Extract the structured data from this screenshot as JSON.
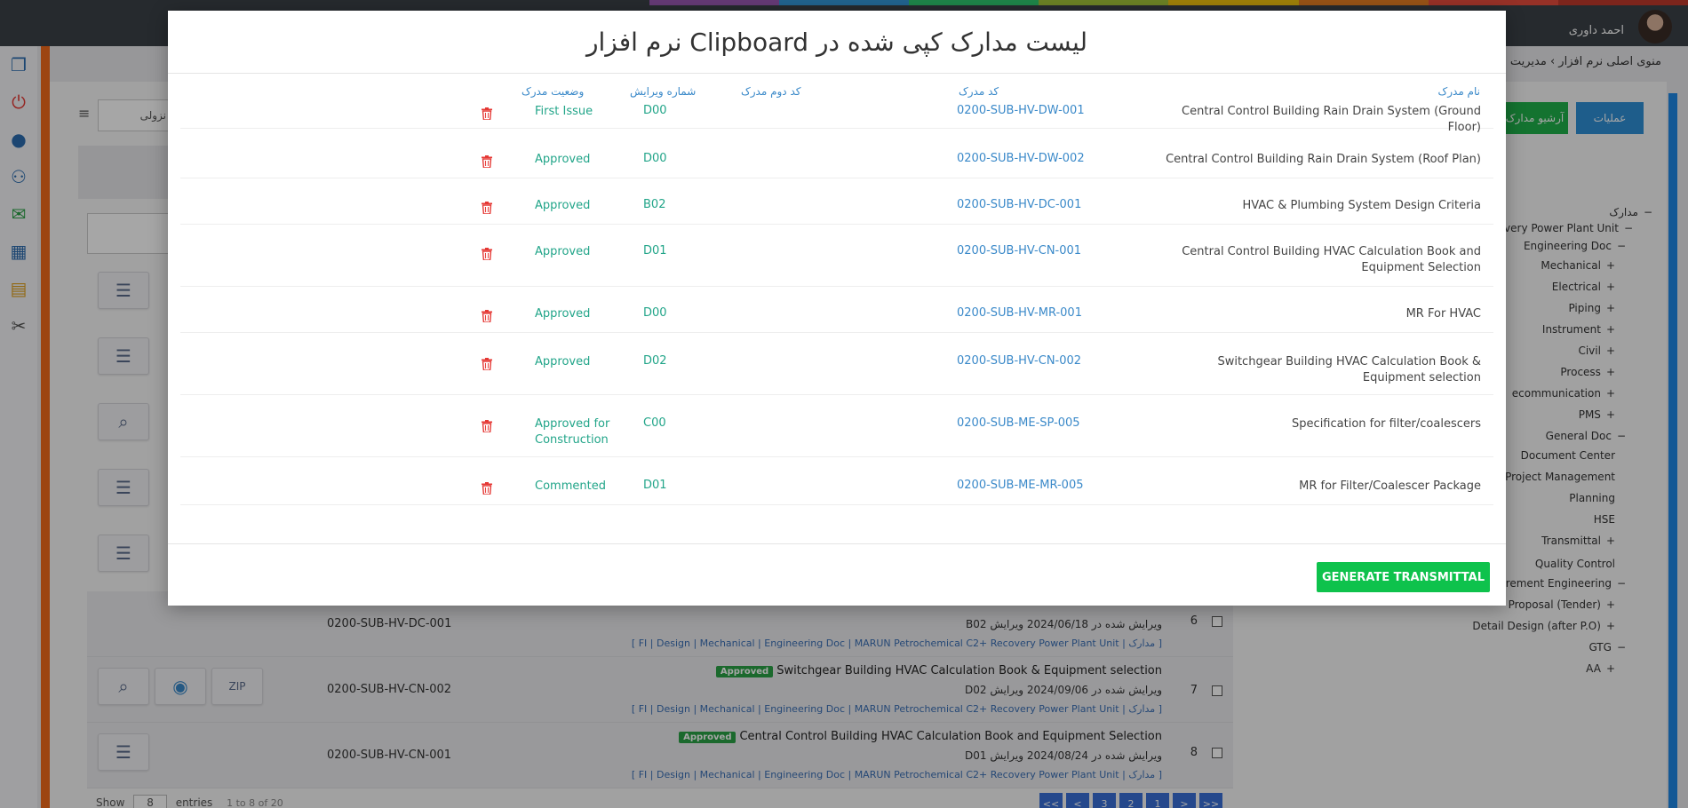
{
  "header": {
    "user_name": "احمد داوری",
    "breadcrumb": "منوی اصلی نرم افزار  ›  مدیریت",
    "rainbow": [
      "#3b4147",
      "#3b4147",
      "#3b4147",
      "#3b4147",
      "#3b4147",
      "#9b59b6",
      "#3498db",
      "#2ecc71",
      "#a4c639",
      "#f1c40f",
      "#e67e22",
      "#e74c3c",
      "#c0392b"
    ]
  },
  "background": {
    "filter_label": "نزولی",
    "btn_ops": "عملیات",
    "btn_archive": "آرشیو مدارک",
    "rows": [
      {
        "num": "6",
        "code": "0200-SUB-HV-DC-001",
        "badge": "",
        "title": "",
        "revline": "ویرایش شده در  2024/06/18   ویرایش B02",
        "path": "[ FI | Design | Mechanical | Engineering Doc | MARUN Petrochemical C2+ Recovery Power Plant Unit | مدارک ]"
      },
      {
        "num": "7",
        "code": "0200-SUB-HV-CN-002",
        "badge": "Approved",
        "title": "Switchgear Building HVAC Calculation Book & Equipment selection",
        "revline": "ویرایش شده در  2024/09/06   ویرایش D02",
        "path": "[ FI | Design | Mechanical | Engineering Doc | MARUN Petrochemical C2+ Recovery Power Plant Unit | مدارک ]"
      },
      {
        "num": "8",
        "code": "0200-SUB-HV-CN-001",
        "badge": "Approved",
        "title": "Central Control Building HVAC Calculation Book and Equipment Selection",
        "revline": "ویرایش شده در  2024/08/24   ویرایش D01",
        "path": "[ FI | Design | Mechanical | Engineering Doc | MARUN Petrochemical C2+ Recovery Power Plant Unit | مدارک ]"
      }
    ],
    "show_label": "Show",
    "show_value": "8",
    "entries_label": "entries",
    "entries_info": "1 to 8 of 20",
    "pager": [
      "<<",
      "<",
      "3",
      "2",
      "1",
      ">",
      ">>"
    ],
    "tree": [
      {
        "label": "مدارک",
        "sign": "−"
      },
      {
        "label": "overy Power Plant Unit",
        "sign": "−"
      },
      {
        "label": "Engineering Doc",
        "sign": "−"
      },
      {
        "label": "Mechanical",
        "sign": "+"
      },
      {
        "label": "Electrical",
        "sign": "+"
      },
      {
        "label": "Piping",
        "sign": "+"
      },
      {
        "label": "Instrument",
        "sign": "+"
      },
      {
        "label": "Civil",
        "sign": "+"
      },
      {
        "label": "Process",
        "sign": "+"
      },
      {
        "label": "ecommunication",
        "sign": "+"
      },
      {
        "label": "PMS",
        "sign": "+"
      },
      {
        "label": "General Doc",
        "sign": "−"
      },
      {
        "label": "Document Center",
        "sign": ""
      },
      {
        "label": "Project Management",
        "sign": ""
      },
      {
        "label": "Planning",
        "sign": ""
      },
      {
        "label": "HSE",
        "sign": ""
      },
      {
        "label": "Transmittal",
        "sign": "+"
      },
      {
        "label": "Quality Control",
        "sign": ""
      },
      {
        "label": "rement Engineering",
        "sign": "−"
      },
      {
        "label": "Proposal (Tender)",
        "sign": "+"
      },
      {
        "label": "Detail Design (after P.O)",
        "sign": "+"
      },
      {
        "label": "GTG",
        "sign": "−"
      },
      {
        "label": "AA",
        "sign": "+"
      }
    ]
  },
  "modal": {
    "title": "لیست مدارک کپی شده در Clipboard نرم افزار",
    "columns": {
      "name": "نام مدرک",
      "code": "کد مدرک",
      "second_code": "کد دوم مدرک",
      "revision": "شماره ویرایش",
      "status": "وضعیت مدرک"
    },
    "rows": [
      {
        "name": "Central Control Building Rain Drain System (Ground Floor)",
        "code": "0200-SUB-HV-DW-001",
        "rev": "D00",
        "status": "First Issue"
      },
      {
        "name": "Central Control Building Rain Drain System (Roof Plan)",
        "code": "0200-SUB-HV-DW-002",
        "rev": "D00",
        "status": "Approved"
      },
      {
        "name": "HVAC & Plumbing System Design Criteria",
        "code": "0200-SUB-HV-DC-001",
        "rev": "B02",
        "status": "Approved"
      },
      {
        "name": "Central Control Building HVAC Calculation Book and Equipment Selection",
        "code": "0200-SUB-HV-CN-001",
        "rev": "D01",
        "status": "Approved"
      },
      {
        "name": "MR For HVAC",
        "code": "0200-SUB-HV-MR-001",
        "rev": "D00",
        "status": "Approved"
      },
      {
        "name": "Switchgear Building HVAC Calculation Book & Equipment selection",
        "code": "0200-SUB-HV-CN-002",
        "rev": "D02",
        "status": "Approved"
      },
      {
        "name": "Specification for filter/coalescers",
        "code": "0200-SUB-ME-SP-005",
        "rev": "C00",
        "status": "Approved for Construction"
      },
      {
        "name": "MR for Filter/Coalescer Package",
        "code": "0200-SUB-ME-MR-005",
        "rev": "D01",
        "status": "Commented"
      }
    ],
    "generate_label": "GENERATE TRANSMITTAL"
  },
  "colors": {
    "accent_blue": "#3a89c9",
    "status_teal": "#22a589",
    "delete_red": "#e53935",
    "generate_green": "#0ec24c"
  }
}
